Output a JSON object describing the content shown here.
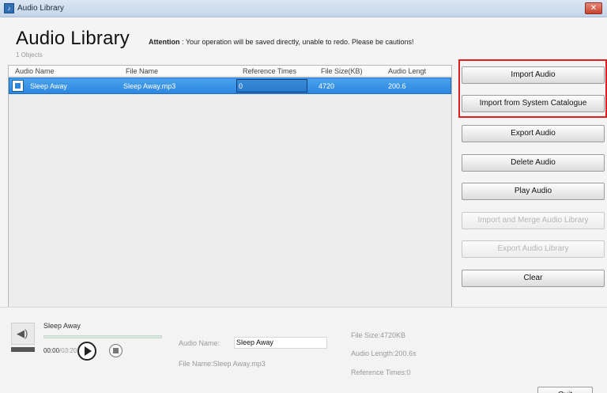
{
  "window": {
    "title": "Audio Library",
    "icon": "app-icon",
    "close_glyph": "✕"
  },
  "header": {
    "title": "Audio Library",
    "attention_label": "Attention",
    "attention_text": " : Your operation will be saved directly, unable to redo. Please be cautions!",
    "object_count": "1 Objects"
  },
  "table": {
    "columns": [
      "Audio Name",
      "File Name",
      "Reference Times",
      "File Size(KB)",
      "Audio Lengt"
    ],
    "rows": [
      {
        "audio_name": "Sleep Away",
        "file_name": "Sleep Away.mp3",
        "reference_times": "0",
        "file_size": "4720",
        "audio_length": "200.6"
      }
    ]
  },
  "buttons": {
    "import_audio": "Import Audio",
    "import_system": "Import from System Catalogue",
    "export_audio": "Export Audio",
    "delete_audio": "Delete Audio",
    "play_audio": "Play Audio",
    "import_merge": "Import and Merge Audio Library",
    "export_library": "Export Audio Library",
    "clear": "Clear",
    "quit": "Quit"
  },
  "player": {
    "track_name": "Sleep Away",
    "time_current": "00:00",
    "time_separator": "/",
    "time_total": "03:20",
    "progress": 0
  },
  "details": {
    "audio_name_label": "Audio Name:",
    "audio_name_value": "Sleep Away",
    "file_name_label": "File Name:",
    "file_name_value": "Sleep Away.mp3",
    "file_size_label": "File Size:",
    "file_size_value": "4720KB",
    "audio_length_label": "Audio Length:",
    "audio_length_value": "200.6s",
    "reference_times_label": "Reference Times:",
    "reference_times_value": "0"
  },
  "colors": {
    "selection": "#2d86de",
    "highlight_border": "#e02020",
    "progress_fill": "#3a9a55"
  }
}
